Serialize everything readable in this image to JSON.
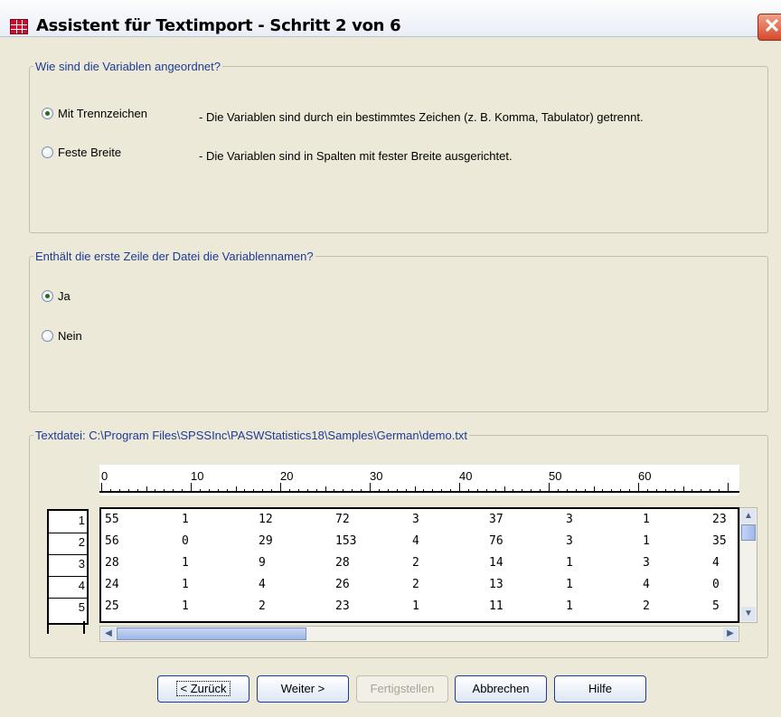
{
  "window": {
    "title": "Assistent für Textimport - Schritt 2 von 6",
    "close_glyph": "✕"
  },
  "arrangement": {
    "legend": "Wie sind die Variablen angeordnet?",
    "options": [
      {
        "label": "Mit Trennzeichen",
        "desc": "- Die Variablen sind durch ein bestimmtes Zeichen (z. B. Komma, Tabulator) getrennt.",
        "selected": true
      },
      {
        "label": "Feste Breite",
        "desc": "- Die Variablen sind in Spalten mit fester Breite ausgerichtet.",
        "selected": false
      }
    ]
  },
  "header_row": {
    "legend": "Enthält die erste Zeile der Datei die Variablennamen?",
    "options": [
      {
        "label": "Ja",
        "selected": true
      },
      {
        "label": "Nein",
        "selected": false
      }
    ]
  },
  "preview": {
    "legend": "Textdatei: C:\\Program Files\\SPSSInc\\PASWStatistics18\\Samples\\German\\demo.txt",
    "ruler_labels": [
      "0",
      "10",
      "20",
      "30",
      "40",
      "50",
      "60"
    ],
    "row_numbers": [
      "1",
      "2",
      "3",
      "4",
      "5"
    ],
    "rows": [
      [
        "55",
        "1",
        "12",
        "72",
        "3",
        "37",
        "3",
        "1",
        "23"
      ],
      [
        "56",
        "0",
        "29",
        "153",
        "4",
        "76",
        "3",
        "1",
        "35"
      ],
      [
        "28",
        "1",
        "9",
        "28",
        "2",
        "14",
        "1",
        "3",
        "4"
      ],
      [
        "24",
        "1",
        "4",
        "26",
        "2",
        "13",
        "1",
        "4",
        "0"
      ],
      [
        "25",
        "1",
        "2",
        "23",
        "1",
        "11",
        "1",
        "2",
        "5"
      ]
    ]
  },
  "buttons": {
    "back": "< Zurück",
    "next": "Weiter >",
    "finish": "Fertigstellen",
    "cancel": "Abbrechen",
    "help": "Hilfe"
  },
  "icons": {
    "app": "spss-table-icon",
    "close": "close-icon"
  },
  "colors": {
    "legend": "#1c3a98",
    "button_border": "#1c3a98",
    "close": "#d54a2b"
  }
}
